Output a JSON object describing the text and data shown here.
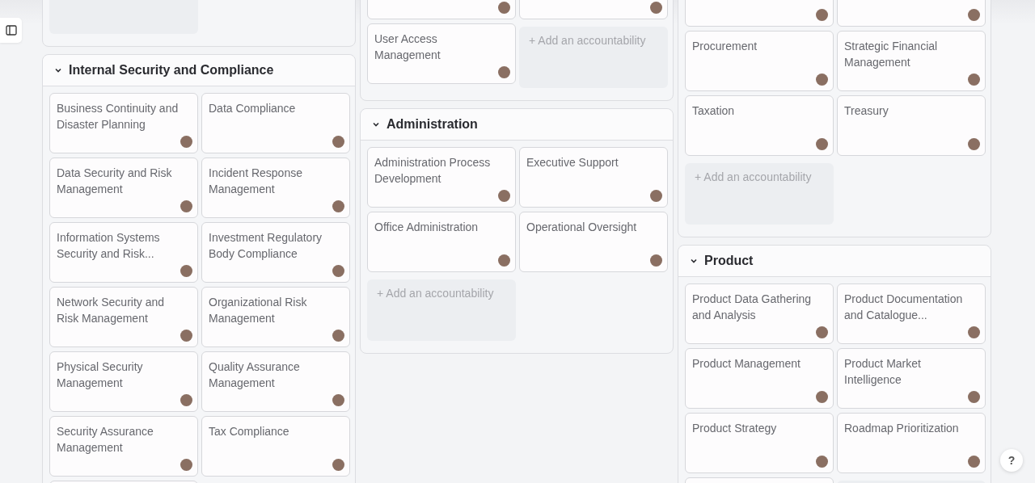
{
  "columns": [
    {
      "panels": [
        {
          "items": [
            {
              "kind": "add"
            }
          ]
        },
        {
          "title": "Internal Security and Compliance",
          "expanded": true,
          "items": [
            {
              "kind": "card",
              "title": "Business Continuity and Disaster Planning"
            },
            {
              "kind": "card",
              "title": "Data Compliance"
            },
            {
              "kind": "card",
              "title": "Data Security and Risk Management"
            },
            {
              "kind": "card",
              "title": "Incident Response Management"
            },
            {
              "kind": "card",
              "title": "Information Systems Security and Risk..."
            },
            {
              "kind": "card",
              "title": "Investment Regulatory Body Compliance"
            },
            {
              "kind": "card",
              "title": "Network Security and Risk Management"
            },
            {
              "kind": "card",
              "title": "Organizational Risk Management"
            },
            {
              "kind": "card",
              "title": "Physical Security Management"
            },
            {
              "kind": "card",
              "title": "Quality Assurance Management"
            },
            {
              "kind": "card",
              "title": "Security Assurance Management"
            },
            {
              "kind": "card",
              "title": "Tax Compliance"
            },
            {
              "kind": "card"
            }
          ]
        }
      ]
    },
    {
      "panels": [
        {
          "items": [
            {
              "kind": "card"
            },
            {
              "kind": "card"
            },
            {
              "kind": "card",
              "title": "User Access Management"
            },
            {
              "kind": "add",
              "label": "+ Add an accountability"
            }
          ]
        },
        {
          "title": "Administration",
          "expanded": true,
          "items": [
            {
              "kind": "card",
              "title": "Administration Process Development"
            },
            {
              "kind": "card",
              "title": "Executive Support"
            },
            {
              "kind": "card",
              "title": "Office Administration"
            },
            {
              "kind": "card",
              "title": "Operational Oversight"
            },
            {
              "kind": "add",
              "label": "+ Add an accountability"
            }
          ]
        }
      ]
    },
    {
      "panels": [
        {
          "items": [
            {
              "kind": "card"
            },
            {
              "kind": "card"
            },
            {
              "kind": "card",
              "title": "Procurement"
            },
            {
              "kind": "card",
              "title": "Strategic Financial Management"
            },
            {
              "kind": "card",
              "title": "Taxation"
            },
            {
              "kind": "card",
              "title": "Treasury"
            },
            {
              "kind": "add",
              "label": "+ Add an accountability"
            }
          ]
        },
        {
          "title": "Product",
          "expanded": true,
          "items": [
            {
              "kind": "card",
              "title": "Product Data Gathering and Analysis"
            },
            {
              "kind": "card",
              "title": "Product Documentation and Catalogue..."
            },
            {
              "kind": "card",
              "title": "Product Management"
            },
            {
              "kind": "card",
              "title": "Product Market Intelligence"
            },
            {
              "kind": "card",
              "title": "Product Strategy"
            },
            {
              "kind": "card",
              "title": "Roadmap Prioritization"
            },
            {
              "kind": "card"
            },
            {
              "kind": "add"
            }
          ]
        }
      ]
    }
  ],
  "help_button": "?"
}
